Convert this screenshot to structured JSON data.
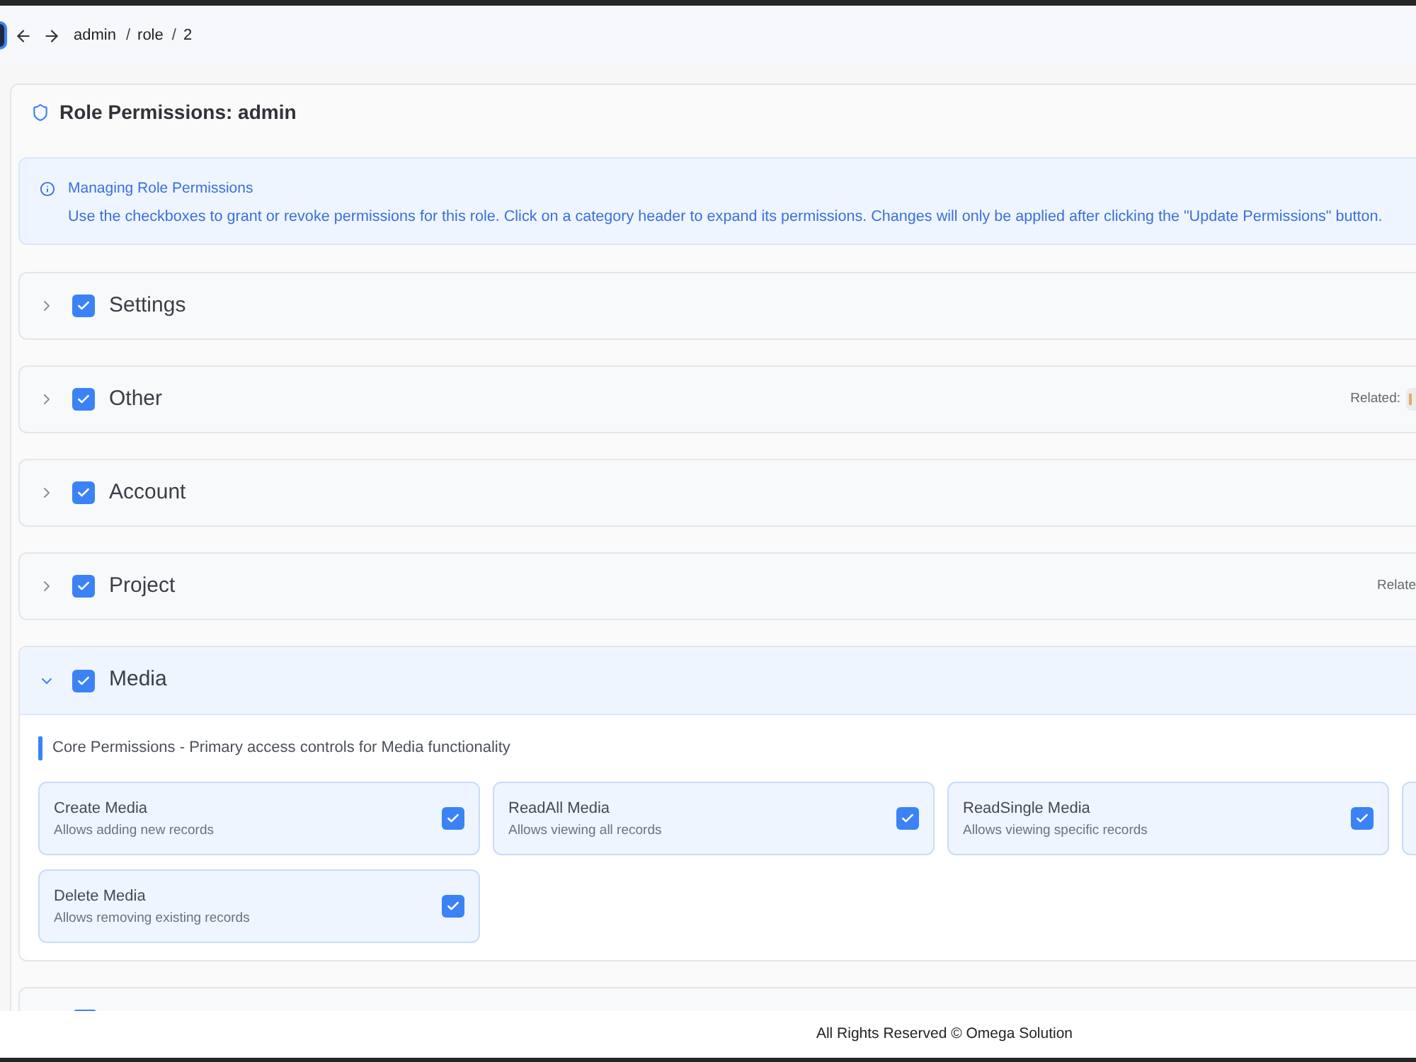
{
  "nav": {
    "breadcrumb": [
      {
        "kind": "link",
        "label": "admin"
      },
      {
        "kind": "separator",
        "label": "/"
      },
      {
        "kind": "link",
        "label": "role"
      },
      {
        "kind": "separator",
        "label": "/"
      },
      {
        "kind": "current",
        "label": "2"
      }
    ]
  },
  "card": {
    "title": "Role Permissions: admin"
  },
  "info": {
    "title": "Managing Role Permissions",
    "text": "Use the checkboxes to grant or revoke permissions for this role. Click on a category header to expand its permissions. Changes will only be applied after clicking the \"Update Permissions\" button."
  },
  "categories": [
    {
      "kind": "category",
      "label": "Settings",
      "expanded": false,
      "checked": true
    },
    {
      "kind": "category",
      "label": "Other",
      "expanded": false,
      "checked": true,
      "related": {
        "label": "Related:",
        "tag": true
      }
    },
    {
      "kind": "category",
      "label": "Account",
      "expanded": false,
      "checked": true
    },
    {
      "kind": "category",
      "label": "Project",
      "expanded": false,
      "checked": true,
      "related": {
        "label": "Relate"
      }
    },
    {
      "kind": "category",
      "label": "Media",
      "expanded": true,
      "checked": true,
      "section_title": "Core Permissions - Primary access controls for Media functionality",
      "permissions": [
        {
          "kind": "permission",
          "title": "Create Media",
          "description": "Allows adding new records",
          "checked": true
        },
        {
          "kind": "permission",
          "title": "ReadAll Media",
          "description": "Allows viewing all records",
          "checked": true
        },
        {
          "kind": "permission",
          "title": "ReadSingle Media",
          "description": "Allows viewing specific records",
          "checked": true
        },
        {
          "kind": "clipped"
        },
        {
          "kind": "permission",
          "title": "Delete Media",
          "description": "Allows removing existing records",
          "checked": true
        }
      ]
    },
    {
      "kind": "clipped",
      "checked": true
    }
  ],
  "footer": {
    "text": "All Rights Reserved © Omega Solution"
  }
}
